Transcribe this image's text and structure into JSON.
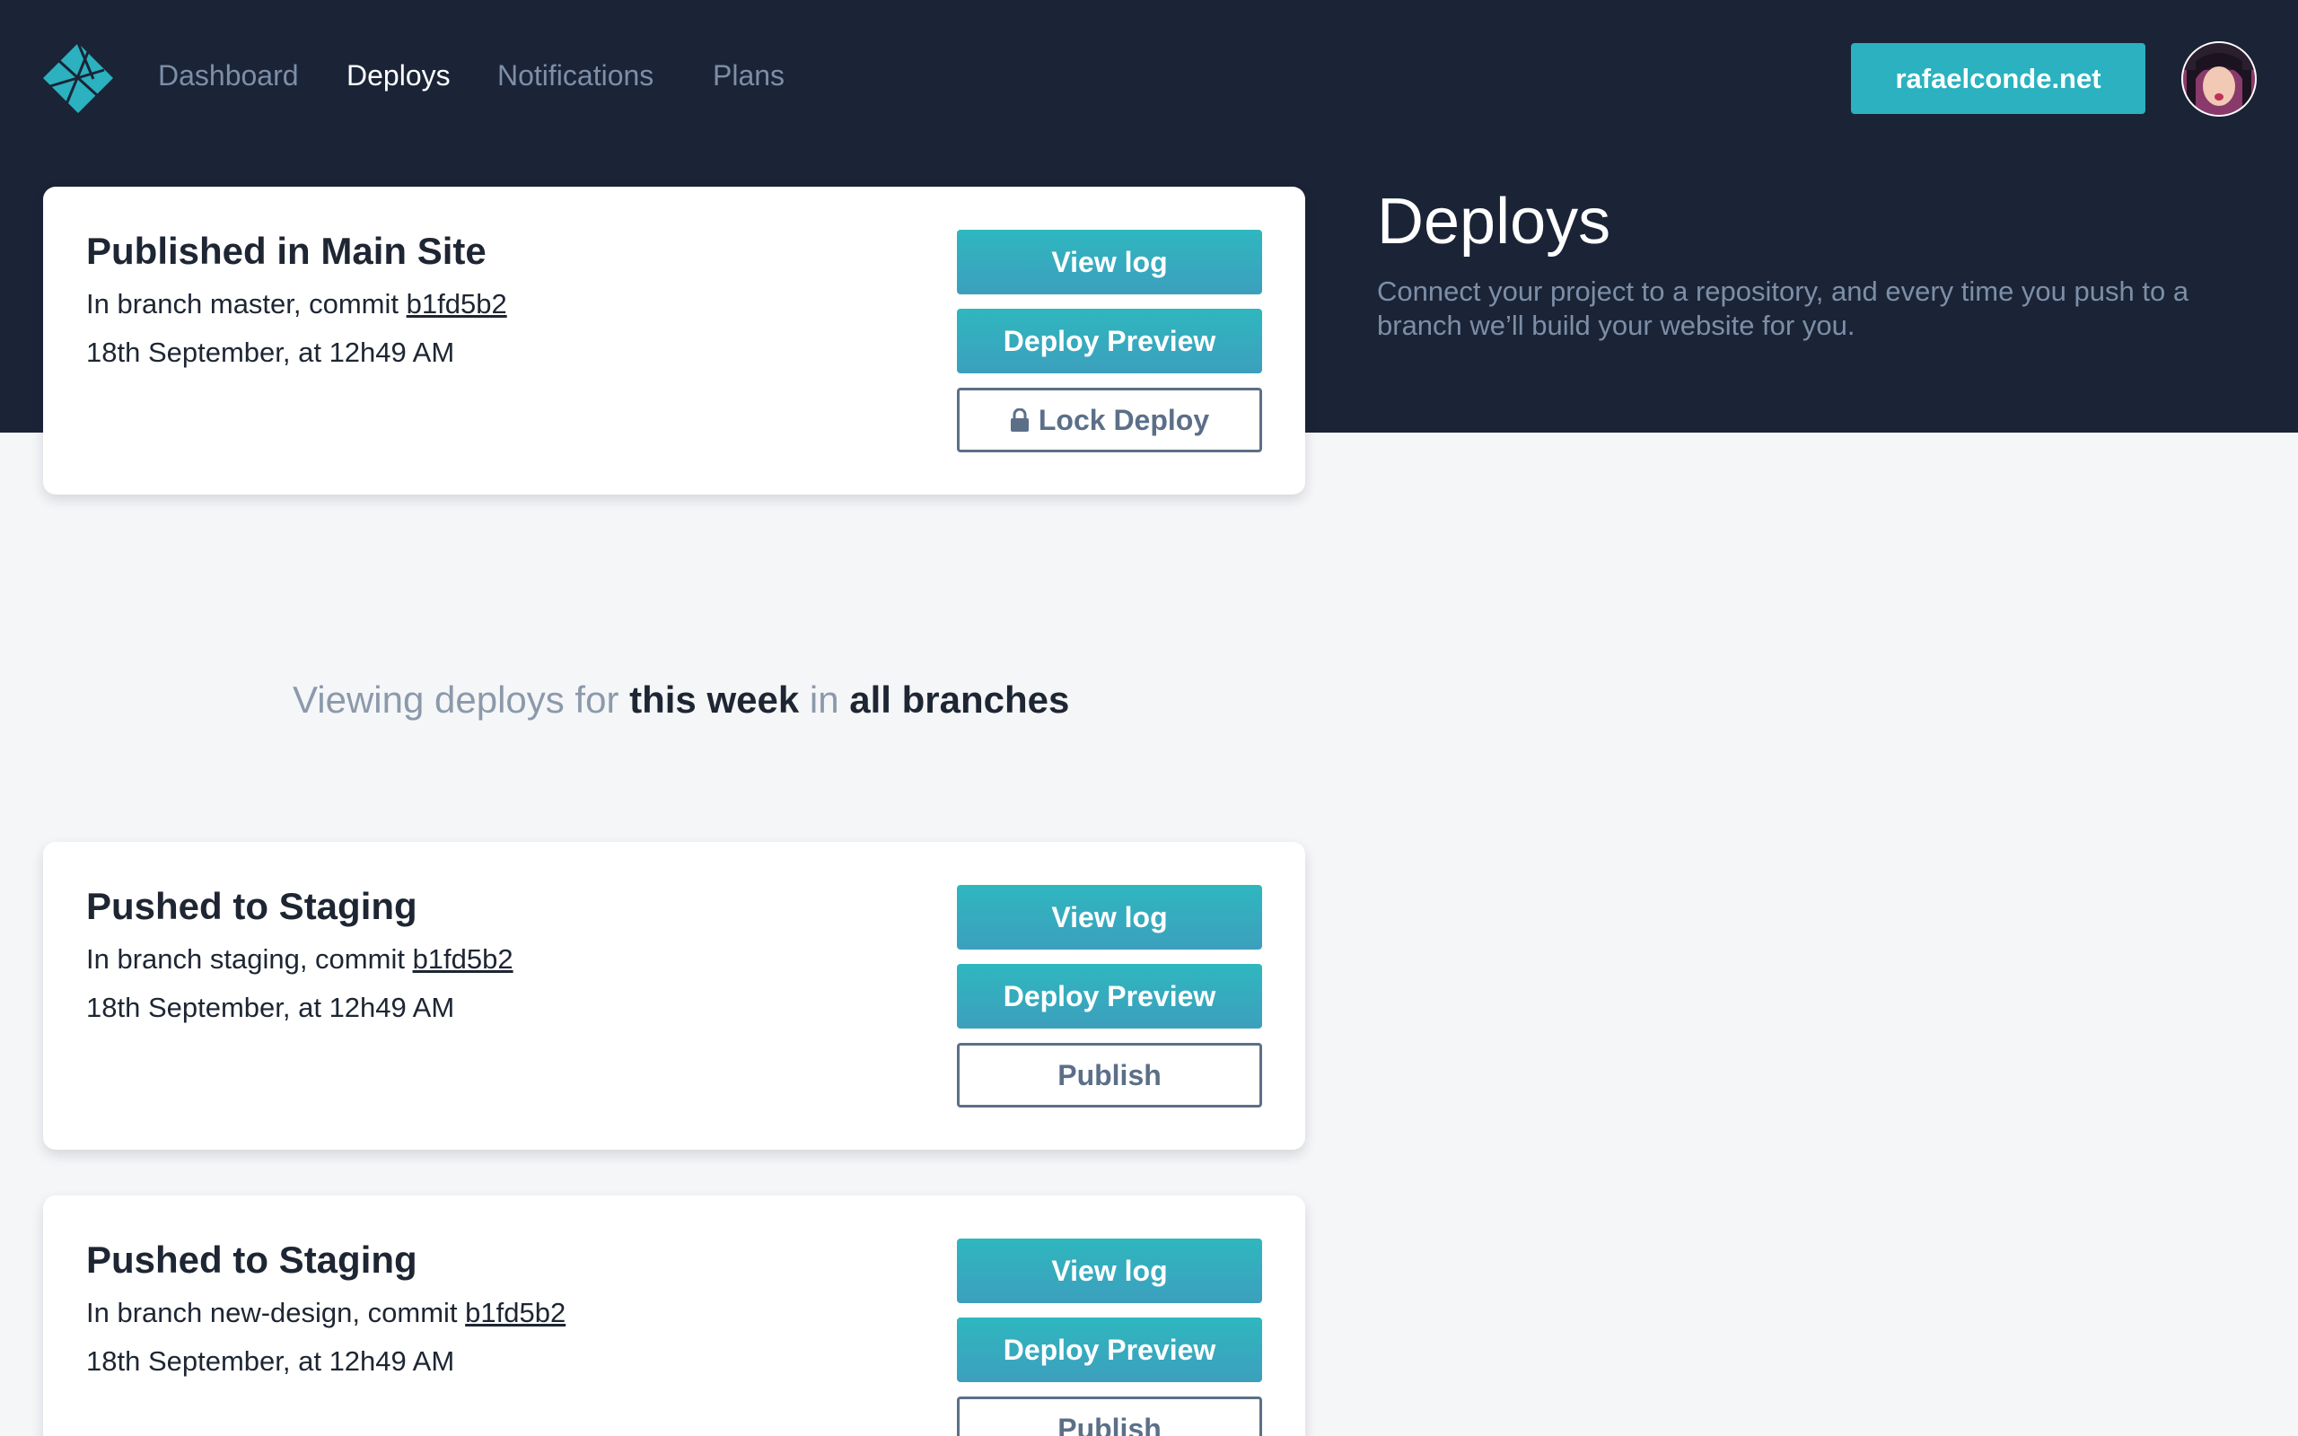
{
  "nav": {
    "links": [
      "Dashboard",
      "Deploys",
      "Notifications",
      "Plans"
    ],
    "active": "Deploys",
    "site_button": "rafaelconde.net",
    "colors": {
      "header_bg": "#1a2436",
      "accent": "#2bb1bf",
      "muted": "#7d8ea8"
    }
  },
  "hero": {
    "title": "Deploys",
    "description": "Connect your project to a repository, and every time you push to a branch we’ll build your website for you."
  },
  "published_card": {
    "title": "Published in Main Site",
    "branch_prefix": "In branch master, commit ",
    "commit": "b1fd5b2",
    "date": "18th September, at 12h49 AM",
    "buttons": {
      "view_log": "View log",
      "deploy_preview": "Deploy Preview",
      "lock": "Lock Deploy"
    }
  },
  "filter": {
    "prefix": "Viewing deploys for ",
    "period": "this week",
    "middle": " in ",
    "branches": "all branches"
  },
  "deploys": [
    {
      "title": "Pushed to Staging",
      "branch_prefix": "In branch staging, commit ",
      "commit": "b1fd5b2",
      "date": "18th September, at 12h49 AM",
      "buttons": {
        "view_log": "View log",
        "deploy_preview": "Deploy Preview",
        "publish": "Publish"
      }
    },
    {
      "title": "Pushed to Staging",
      "branch_prefix": "In branch new-design, commit ",
      "commit": "b1fd5b2",
      "date": "18th September, at 12h49 AM",
      "buttons": {
        "view_log": "View log",
        "deploy_preview": "Deploy Preview",
        "publish": "Publish"
      }
    }
  ]
}
